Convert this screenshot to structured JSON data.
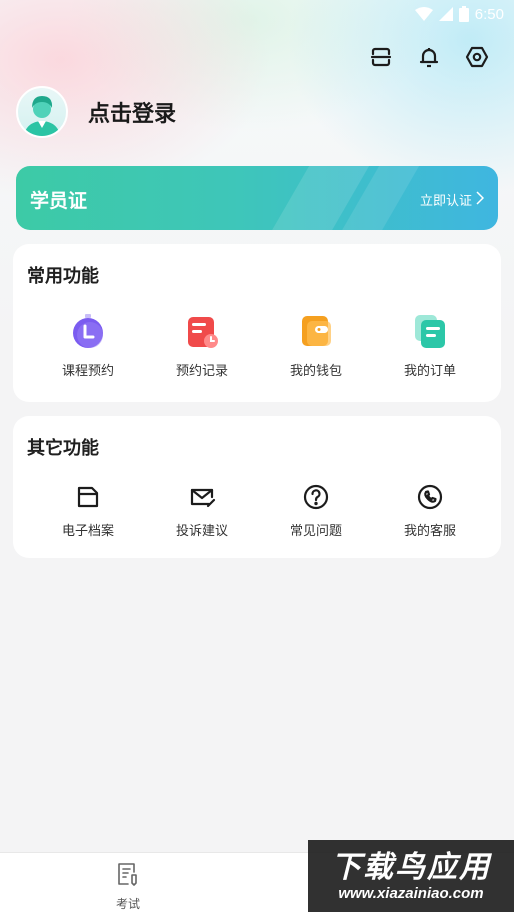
{
  "status_bar": {
    "time": "6:50"
  },
  "header": {
    "icons": [
      "scan-icon",
      "bell-icon",
      "settings-icon"
    ]
  },
  "profile": {
    "login_text": "点击登录"
  },
  "student_card": {
    "title": "学员证",
    "action": "立即认证"
  },
  "common_functions": {
    "title": "常用功能",
    "items": [
      {
        "label": "课程预约",
        "icon": "clock-icon",
        "color": "#7b5cf0"
      },
      {
        "label": "预约记录",
        "icon": "calendar-icon",
        "color": "#f04a4a"
      },
      {
        "label": "我的钱包",
        "icon": "wallet-icon",
        "color": "#f5a020"
      },
      {
        "label": "我的订单",
        "icon": "order-icon",
        "color": "#2cc7a8"
      }
    ]
  },
  "other_functions": {
    "title": "其它功能",
    "items": [
      {
        "label": "电子档案",
        "icon": "folder-icon"
      },
      {
        "label": "投诉建议",
        "icon": "mail-icon"
      },
      {
        "label": "常见问题",
        "icon": "question-icon"
      },
      {
        "label": "我的客服",
        "icon": "phone-icon"
      }
    ]
  },
  "bottom_nav": {
    "items": [
      {
        "label": "考试",
        "icon": "exam-icon"
      }
    ]
  },
  "watermark": {
    "title": "下载鸟应用",
    "url": "www.xiazainiao.com"
  }
}
